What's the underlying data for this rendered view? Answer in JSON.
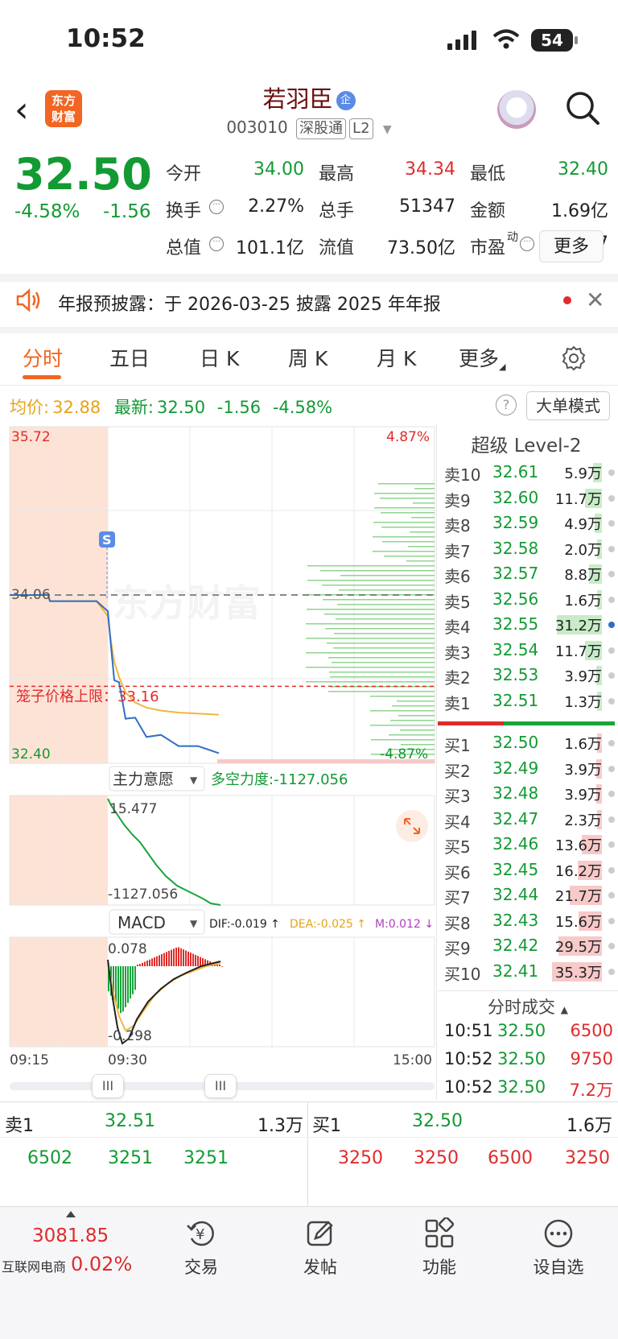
{
  "status": {
    "time": "10:52",
    "battery": "54"
  },
  "header": {
    "logo_line1": "东方",
    "logo_line2": "财富",
    "stock_name": "若羽臣",
    "enterprise_badge": "企",
    "stock_code": "003010",
    "exchange_tag": "深股通",
    "level_tag": "L2"
  },
  "quote": {
    "price": "32.50",
    "pct": "-4.58%",
    "change": "-1.56",
    "fields": [
      {
        "label": "今开",
        "value": "34.00",
        "color": "green"
      },
      {
        "label": "最高",
        "value": "34.34",
        "color": "red"
      },
      {
        "label": "最低",
        "value": "32.40",
        "color": "green"
      },
      {
        "label": "换手",
        "value": "2.27%",
        "color": "dark"
      },
      {
        "label": "总手",
        "value": "51347",
        "color": "dark"
      },
      {
        "label": "金额",
        "value": "1.69亿",
        "color": "dark"
      },
      {
        "label": "总值",
        "value": "101.1亿",
        "color": "dark"
      },
      {
        "label": "流值",
        "value": "73.50亿",
        "color": "dark"
      },
      {
        "label": "市盈",
        "value": "72.37",
        "color": "dark"
      }
    ],
    "pe_superscript": "动",
    "more_label": "更多"
  },
  "notice": {
    "text": "年报预披露：于 2026-03-25 披露 2025 年年报"
  },
  "tabs": [
    "分时",
    "五日",
    "日 K",
    "周 K",
    "月 K",
    "更多"
  ],
  "avg_row": {
    "avg_label": "均价:",
    "avg_value": "32.88",
    "last_label": "最新:",
    "last_value": "32.50",
    "last_change": "-1.56",
    "last_pct": "-4.58%",
    "help": "?",
    "big_order_label": "大单模式"
  },
  "chart": {
    "y_max_label": "35.72",
    "y_min_label": "32.40",
    "pct_max_label": "4.87%",
    "pct_min_label": "-4.87%",
    "prev_close_label": "34.06",
    "cage_label": "笼子价格上限：33.16",
    "watermark": "东方财富",
    "s_marker": "S",
    "indicator1_name": "主力意愿",
    "indicator1_reading": "多空力度:-1127.056",
    "ind1_top": "15.477",
    "ind1_bottom": "-1127.056",
    "indicator2_name": "MACD",
    "dif": "DIF:-0.019 ↑",
    "dea": "DEA:-0.025 ↑",
    "m": "M:0.012 ↓",
    "macd_top": "0.078",
    "macd_bottom": "-0.298",
    "time_start": "09:15",
    "time_mid": "09:30",
    "time_end": "15:00",
    "slider_handle": "III"
  },
  "chart_data": {
    "type": "line",
    "title": "",
    "ylim": [
      32.4,
      35.72
    ],
    "prev_close": 34.06,
    "cage_upper": 33.16,
    "series": [
      {
        "values": [
          34.06,
          34.06,
          34.0,
          34.0,
          33.9,
          33.5,
          33.3,
          33.1,
          32.9,
          32.8,
          32.7,
          32.65,
          32.6,
          32.55,
          32.5
        ]
      },
      {
        "values": [
          34.06,
          34.06,
          34.0,
          34.0,
          33.85,
          33.6,
          33.4,
          33.25,
          33.1,
          33.0,
          32.95,
          32.92,
          32.9,
          32.89,
          32.88
        ]
      }
    ]
  },
  "orderbook": {
    "title": "超级 Level-2",
    "asks": [
      {
        "label": "卖10",
        "price": "32.61",
        "vol": "5.9万",
        "w": 0.18
      },
      {
        "label": "卖9",
        "price": "32.60",
        "vol": "11.7万",
        "w": 0.34
      },
      {
        "label": "卖8",
        "price": "32.59",
        "vol": "4.9万",
        "w": 0.15
      },
      {
        "label": "卖7",
        "price": "32.58",
        "vol": "2.0万",
        "w": 0.07
      },
      {
        "label": "卖6",
        "price": "32.57",
        "vol": "8.8万",
        "w": 0.26
      },
      {
        "label": "卖5",
        "price": "32.56",
        "vol": "1.6万",
        "w": 0.05
      },
      {
        "label": "卖4",
        "price": "32.55",
        "vol": "31.2万",
        "w": 0.9
      },
      {
        "label": "卖3",
        "price": "32.54",
        "vol": "11.7万",
        "w": 0.34
      },
      {
        "label": "卖2",
        "price": "32.53",
        "vol": "3.9万",
        "w": 0.12
      },
      {
        "label": "卖1",
        "price": "32.51",
        "vol": "1.3万",
        "w": 0.04
      }
    ],
    "bids": [
      {
        "label": "买1",
        "price": "32.50",
        "vol": "1.6万",
        "w": 0.05
      },
      {
        "label": "买2",
        "price": "32.49",
        "vol": "3.9万",
        "w": 0.12
      },
      {
        "label": "买3",
        "price": "32.48",
        "vol": "3.9万",
        "w": 0.12
      },
      {
        "label": "买4",
        "price": "32.47",
        "vol": "2.3万",
        "w": 0.07
      },
      {
        "label": "买5",
        "price": "32.46",
        "vol": "13.6万",
        "w": 0.4
      },
      {
        "label": "买6",
        "price": "32.45",
        "vol": "16.2万",
        "w": 0.48
      },
      {
        "label": "买7",
        "price": "32.44",
        "vol": "21.7万",
        "w": 0.64
      },
      {
        "label": "买8",
        "price": "32.43",
        "vol": "15.6万",
        "w": 0.46
      },
      {
        "label": "买9",
        "price": "32.42",
        "vol": "29.5万",
        "w": 0.87
      },
      {
        "label": "买10",
        "price": "32.41",
        "vol": "35.3万",
        "w": 1.0
      }
    ],
    "trades_title": "分时成交",
    "trades": [
      {
        "time": "10:51",
        "price": "32.50",
        "vol": "6500"
      },
      {
        "time": "10:52",
        "price": "32.50",
        "vol": "9750"
      },
      {
        "time": "10:52",
        "price": "32.50",
        "vol": "7.2万"
      }
    ]
  },
  "bottom_quote": {
    "ask_label": "卖1",
    "ask_price": "32.51",
    "ask_vol": "1.3万",
    "bid_label": "买1",
    "bid_price": "32.50",
    "bid_vol": "1.6万",
    "ask_queue": [
      "6502",
      "3251",
      "3251"
    ],
    "bid_queue": [
      "3250",
      "3250",
      "6500",
      "3250"
    ]
  },
  "nav": {
    "index_value": "3081.85",
    "index_name": "互联网电商",
    "index_pct": "0.02%",
    "items": [
      "交易",
      "发帖",
      "功能",
      "设自选"
    ]
  },
  "colors": {
    "green": "#129a33",
    "red": "#e02b2b",
    "orange": "#f26522",
    "avg": "#e8a317"
  }
}
